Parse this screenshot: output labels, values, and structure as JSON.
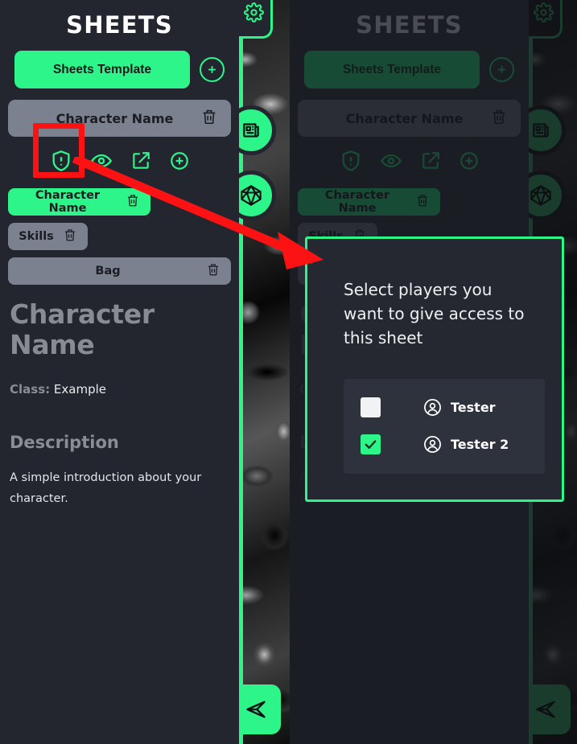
{
  "app": {
    "title": "SHEETS",
    "accent_green": "#2ef58a",
    "background": "#23262e",
    "annotation_red": "#fc1212"
  },
  "sheets_panel": {
    "title": "SHEETS",
    "template_button": "Sheets Template",
    "add_sheet_icon": "plus-circle-icon",
    "selected_sheet": "Character Name",
    "delete_sheet_icon": "trash-icon",
    "actions": [
      {
        "name": "permissions",
        "icon": "shield-alert-icon"
      },
      {
        "name": "visibility",
        "icon": "eye-icon"
      },
      {
        "name": "open-external",
        "icon": "external-link-icon"
      },
      {
        "name": "add-tab",
        "icon": "plus-circle-icon"
      }
    ],
    "tabs": [
      {
        "label": "Character Name",
        "active": true,
        "delete_icon": "trash-icon"
      },
      {
        "label": "Skills",
        "active": false,
        "delete_icon": "trash-icon"
      },
      {
        "label": "Bag",
        "active": false,
        "delete_icon": "trash-icon"
      }
    ]
  },
  "sheet_body": {
    "character_name": "Character Name",
    "class_label": "Class:",
    "class_value": "Example",
    "description_heading": "Description",
    "description_text": "A simple introduction about your character."
  },
  "rail": {
    "settings_icon": "gear-icon",
    "news_icon": "news-icon",
    "dice_icon": "d20-dice-icon",
    "send_icon": "send-icon"
  },
  "access_modal": {
    "title": "Select players you want to give access to this sheet",
    "players": [
      {
        "name": "Tester",
        "checked": false,
        "avatar_icon": "user-circle-icon"
      },
      {
        "name": "Tester 2",
        "checked": true,
        "avatar_icon": "user-circle-icon"
      }
    ]
  },
  "annotations": {
    "highlight_target": "permissions-shield-icon",
    "arrow_points_to": "access-modal"
  }
}
